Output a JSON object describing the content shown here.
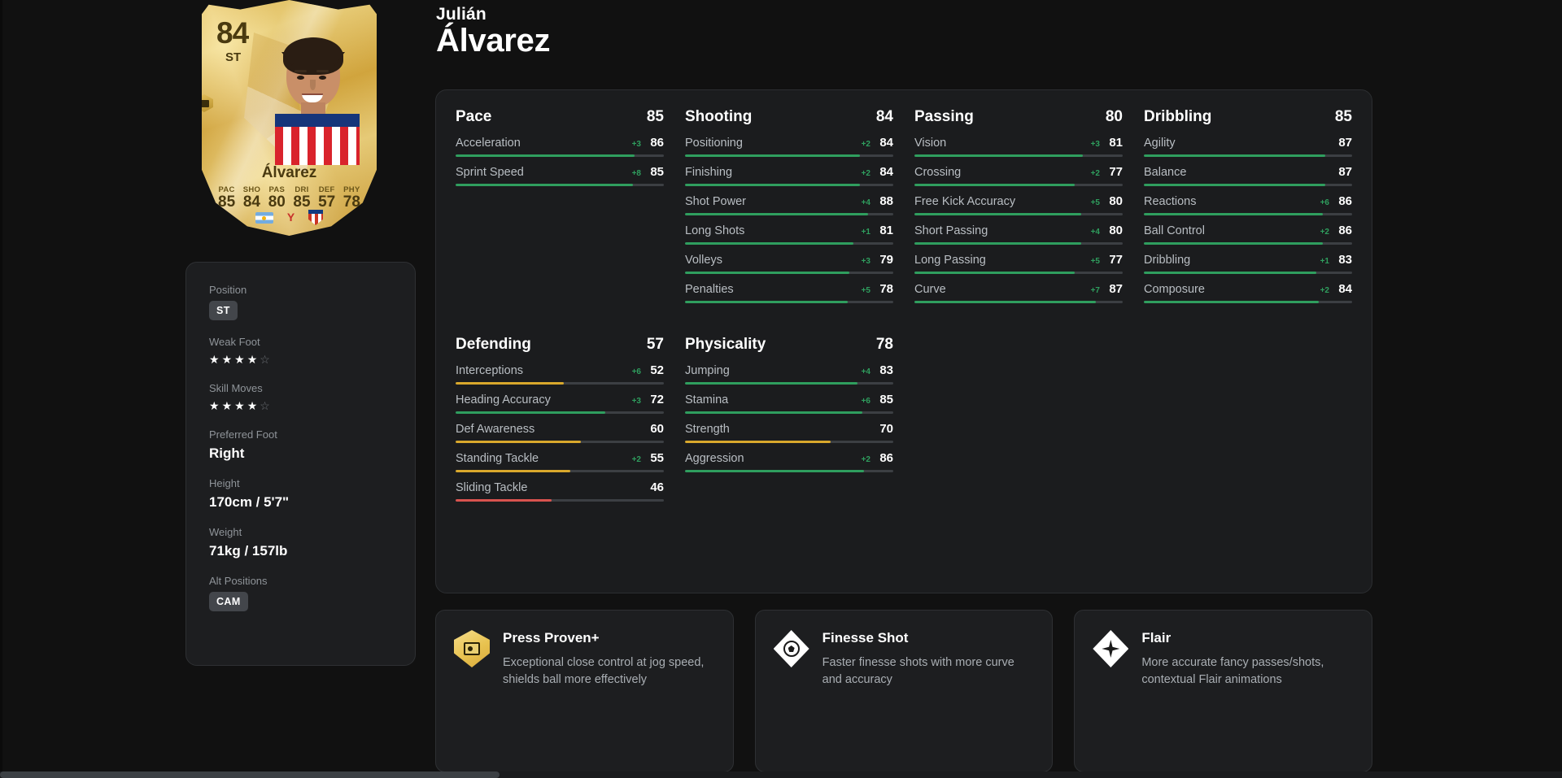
{
  "header": {
    "first_name": "Julián",
    "last_name": "Álvarez"
  },
  "card": {
    "rating": "84",
    "position": "ST",
    "name": "Álvarez",
    "stats": [
      {
        "label": "PAC",
        "value": "85"
      },
      {
        "label": "SHO",
        "value": "84"
      },
      {
        "label": "PAS",
        "value": "80"
      },
      {
        "label": "DRI",
        "value": "85"
      },
      {
        "label": "DEF",
        "value": "57"
      },
      {
        "label": "PHY",
        "value": "78"
      }
    ],
    "nation_icon": "argentina-flag-icon",
    "league_icon": "laliga-logo-icon",
    "club_icon": "atletico-madrid-crest-icon"
  },
  "info": {
    "position_label": "Position",
    "position_value": "ST",
    "weak_foot_label": "Weak Foot",
    "weak_foot": 4,
    "skill_moves_label": "Skill Moves",
    "skill_moves": 4,
    "star_max": 5,
    "preferred_foot_label": "Preferred Foot",
    "preferred_foot_value": "Right",
    "height_label": "Height",
    "height_value": "170cm / 5'7\"",
    "weight_label": "Weight",
    "weight_value": "71kg / 157lb",
    "alt_positions_label": "Alt Positions",
    "alt_positions_value": "CAM"
  },
  "colors": {
    "high": "#2f9e5e",
    "mid": "#d9a82c",
    "low": "#d9534f",
    "track": "#3c3f43",
    "delta": "#2f9e5e"
  },
  "stat_groups": [
    {
      "name": "Pace",
      "value": "85",
      "items": [
        {
          "name": "Acceleration",
          "value": "86",
          "delta": "+3",
          "pct": 86,
          "tier": "high"
        },
        {
          "name": "Sprint Speed",
          "value": "85",
          "delta": "+8",
          "pct": 85,
          "tier": "high"
        }
      ]
    },
    {
      "name": "Shooting",
      "value": "84",
      "items": [
        {
          "name": "Positioning",
          "value": "84",
          "delta": "+2",
          "pct": 84,
          "tier": "high"
        },
        {
          "name": "Finishing",
          "value": "84",
          "delta": "+2",
          "pct": 84,
          "tier": "high"
        },
        {
          "name": "Shot Power",
          "value": "88",
          "delta": "+4",
          "pct": 88,
          "tier": "high"
        },
        {
          "name": "Long Shots",
          "value": "81",
          "delta": "+1",
          "pct": 81,
          "tier": "high"
        },
        {
          "name": "Volleys",
          "value": "79",
          "delta": "+3",
          "pct": 79,
          "tier": "high"
        },
        {
          "name": "Penalties",
          "value": "78",
          "delta": "+5",
          "pct": 78,
          "tier": "high"
        }
      ]
    },
    {
      "name": "Passing",
      "value": "80",
      "items": [
        {
          "name": "Vision",
          "value": "81",
          "delta": "+3",
          "pct": 81,
          "tier": "high"
        },
        {
          "name": "Crossing",
          "value": "77",
          "delta": "+2",
          "pct": 77,
          "tier": "high"
        },
        {
          "name": "Free Kick Accuracy",
          "value": "80",
          "delta": "+5",
          "pct": 80,
          "tier": "high"
        },
        {
          "name": "Short Passing",
          "value": "80",
          "delta": "+4",
          "pct": 80,
          "tier": "high"
        },
        {
          "name": "Long Passing",
          "value": "77",
          "delta": "+5",
          "pct": 77,
          "tier": "high"
        },
        {
          "name": "Curve",
          "value": "87",
          "delta": "+7",
          "pct": 87,
          "tier": "high"
        }
      ]
    },
    {
      "name": "Dribbling",
      "value": "85",
      "items": [
        {
          "name": "Agility",
          "value": "87",
          "delta": "",
          "pct": 87,
          "tier": "high"
        },
        {
          "name": "Balance",
          "value": "87",
          "delta": "",
          "pct": 87,
          "tier": "high"
        },
        {
          "name": "Reactions",
          "value": "86",
          "delta": "+6",
          "pct": 86,
          "tier": "high"
        },
        {
          "name": "Ball Control",
          "value": "86",
          "delta": "+2",
          "pct": 86,
          "tier": "high"
        },
        {
          "name": "Dribbling",
          "value": "83",
          "delta": "+1",
          "pct": 83,
          "tier": "high"
        },
        {
          "name": "Composure",
          "value": "84",
          "delta": "+2",
          "pct": 84,
          "tier": "high"
        }
      ]
    },
    {
      "name": "Defending",
      "value": "57",
      "items": [
        {
          "name": "Interceptions",
          "value": "52",
          "delta": "+6",
          "pct": 52,
          "tier": "mid"
        },
        {
          "name": "Heading Accuracy",
          "value": "72",
          "delta": "+3",
          "pct": 72,
          "tier": "high"
        },
        {
          "name": "Def Awareness",
          "value": "60",
          "delta": "",
          "pct": 60,
          "tier": "mid"
        },
        {
          "name": "Standing Tackle",
          "value": "55",
          "delta": "+2",
          "pct": 55,
          "tier": "mid"
        },
        {
          "name": "Sliding Tackle",
          "value": "46",
          "delta": "",
          "pct": 46,
          "tier": "low"
        }
      ]
    },
    {
      "name": "Physicality",
      "value": "78",
      "items": [
        {
          "name": "Jumping",
          "value": "83",
          "delta": "+4",
          "pct": 83,
          "tier": "high"
        },
        {
          "name": "Stamina",
          "value": "85",
          "delta": "+6",
          "pct": 85,
          "tier": "high"
        },
        {
          "name": "Strength",
          "value": "70",
          "delta": "",
          "pct": 70,
          "tier": "mid"
        },
        {
          "name": "Aggression",
          "value": "86",
          "delta": "+2",
          "pct": 86,
          "tier": "high"
        }
      ]
    }
  ],
  "playstyles": [
    {
      "title": "Press Proven+",
      "description": "Exceptional close control at jog speed, shields ball more effectively",
      "icon": "press-proven-plus-icon",
      "shape": "hexagon",
      "glyph": "inner"
    },
    {
      "title": "Finesse Shot",
      "description": "Faster finesse shots with more curve and accuracy",
      "icon": "finesse-shot-icon",
      "shape": "diamond",
      "glyph": "ball"
    },
    {
      "title": "Flair",
      "description": "More accurate fancy passes/shots, contextual Flair animations",
      "icon": "flair-icon",
      "shape": "diamond",
      "glyph": "spark"
    }
  ]
}
